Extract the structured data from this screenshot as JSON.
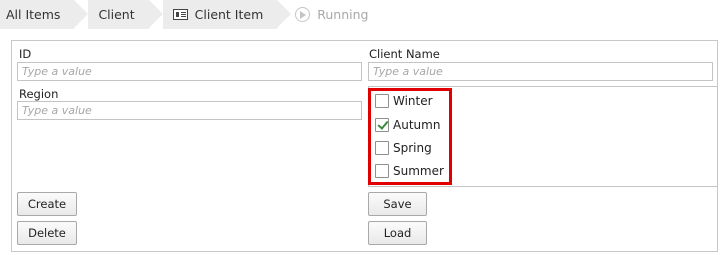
{
  "breadcrumb": {
    "items": [
      {
        "label": "All Items"
      },
      {
        "label": "Client"
      },
      {
        "label": "Client Item",
        "icon": "form-icon"
      }
    ],
    "status": {
      "label": "Running",
      "icon": "play-icon"
    }
  },
  "form": {
    "id": {
      "label": "ID",
      "placeholder": "Type a value"
    },
    "client_name": {
      "label": "Client Name",
      "placeholder": "Type a value"
    },
    "region": {
      "label": "Region",
      "placeholder": "Type a value"
    },
    "seasons": [
      {
        "label": "Winter",
        "checked": false
      },
      {
        "label": "Autumn",
        "checked": true
      },
      {
        "label": "Spring",
        "checked": false
      },
      {
        "label": "Summer",
        "checked": false
      }
    ],
    "buttons": {
      "create": "Create",
      "delete": "Delete",
      "save": "Save",
      "load": "Load"
    }
  },
  "colors": {
    "highlight": "#e00000",
    "checkmark": "#3a8a3a",
    "breadcrumb_bg": "#ececec"
  }
}
